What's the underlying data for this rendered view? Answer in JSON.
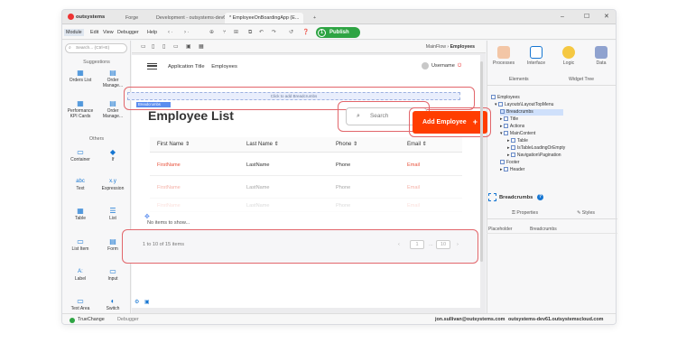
{
  "titlebar": {
    "brand": "outsystems",
    "tabs": [
      "Forge",
      "Development - outsystems-dev61.o...",
      "* EmployeeOnBoardingApp (E...",
      "+"
    ],
    "window_controls": [
      "–",
      "☐",
      "✕"
    ]
  },
  "menubar": {
    "items": [
      "Module",
      "Edit",
      "View",
      "Debugger",
      "Help"
    ],
    "publish_number": "1",
    "publish_label": "Publish"
  },
  "left_panel": {
    "search_placeholder": "Search... (Ctrl+E)",
    "suggestions_title": "Suggestions",
    "suggestions": [
      "Orders List",
      "Order Manage...",
      "Performance KPI Cards",
      "Order Manage..."
    ],
    "others_title": "Others",
    "widgets": [
      "Container",
      "If",
      "Text",
      "Expression",
      "Table",
      "List",
      "List Item",
      "Form",
      "Label",
      "Input",
      "Text Area",
      "Switch"
    ],
    "widget_icons": [
      "container-icon",
      "if-icon",
      "text-icon",
      "expression-icon",
      "table-icon",
      "list-icon",
      "list-item-icon",
      "form-icon",
      "label-icon",
      "input-icon",
      "text-area-icon",
      "switch-icon"
    ]
  },
  "canvas": {
    "crumb_path": "MainFlow",
    "crumb_current": "Employees",
    "app_title": "Application Title",
    "screen_title": "Employees",
    "username": "Username",
    "breadcrumb_placeholder": "Click to add Breadcrumbs",
    "breadcrumb_tag": "Breadcrumbs",
    "page_title": "Employee List",
    "search_placeholder": "Search",
    "add_button": "Add Employee",
    "add_button_icon": "+",
    "columns": [
      "First Name ⇕",
      "Last Name ⇕",
      "Phone ⇕",
      "Email ⇕"
    ],
    "rows": [
      [
        "FirstName",
        "LastName",
        "Phone",
        "Email"
      ],
      [
        "FirstName",
        "LastName",
        "Phone",
        "Email"
      ],
      [
        "FirstName",
        "LastName",
        "Phone",
        "Email"
      ]
    ],
    "no_items": "No items to show...",
    "pagination_info": "1 to 10 of 15 items",
    "pagination": {
      "prev": "‹",
      "page": "1",
      "ellipsis": "...",
      "last": "10",
      "next": "›"
    }
  },
  "right_panel": {
    "tabs": [
      "Processes",
      "Interface",
      "Logic",
      "Data"
    ],
    "subtabs": [
      "Elements",
      "Widget Tree"
    ],
    "tree": [
      "Employees",
      "Layouts\\LayoutTopMenu",
      "Breadcrumbs",
      "Title",
      "Actions",
      "MainContent",
      "Table",
      "IsTableLoadingOrEmpty",
      "Navigation\\Pagination",
      "Footer",
      "Header"
    ],
    "props_title": "Breadcrumbs",
    "props_tabs": [
      "Properties",
      "Styles"
    ],
    "prop_name": "Placeholder",
    "prop_value": "Breadcrumbs"
  },
  "statusbar": {
    "true_change": "TrueChange",
    "debugger": "Debugger",
    "user": "jon.sullivan@outsystems.com",
    "server": "outsystems-dev61.outsystemscloud.com"
  },
  "colors": {
    "accent_red": "#ff3d00",
    "publish_green": "#2ea443",
    "highlight": "#e2666b",
    "interface_blue": "#1676d2"
  }
}
